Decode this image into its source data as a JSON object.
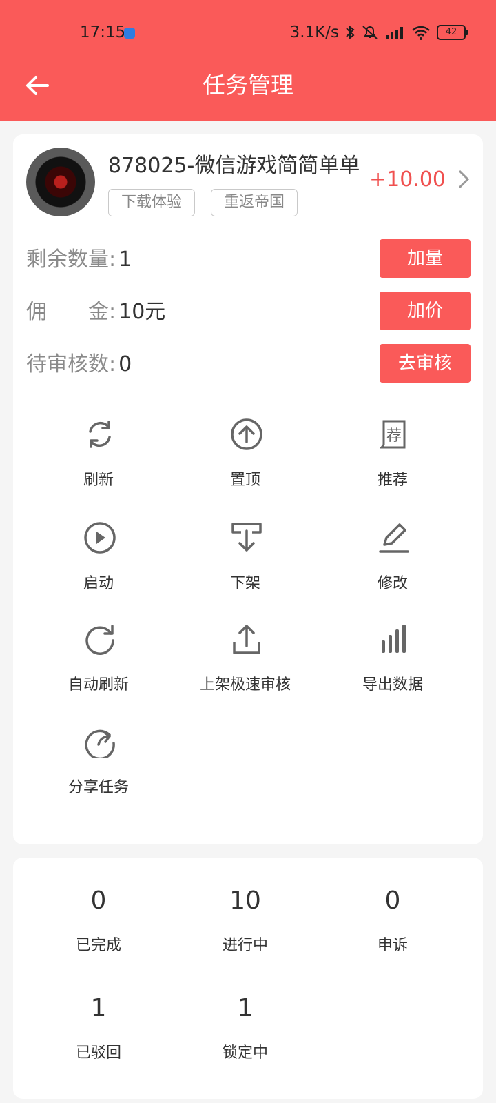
{
  "status_bar": {
    "time": "17:15",
    "net_speed": "3.1K/s",
    "battery": "42"
  },
  "header": {
    "title": "任务管理",
    "accent_color": "#fa5a59"
  },
  "task": {
    "title": "878025-微信游戏简简单单",
    "tags": [
      "下载体验",
      "重返帝国"
    ],
    "price": "+10.00"
  },
  "info": {
    "remaining_label": "剩余数量:",
    "remaining_value": "1",
    "commission_label": "佣　　金:",
    "commission_value": "10元",
    "pending_label": "待审核数:",
    "pending_value": "0",
    "add_qty_button": "加量",
    "add_price_button": "加价",
    "review_button": "去审核"
  },
  "operations": [
    {
      "label": "刷新",
      "icon": "refresh-icon"
    },
    {
      "label": "置顶",
      "icon": "arrow-up-circle-icon"
    },
    {
      "label": "推荐",
      "icon": "recommend-icon"
    },
    {
      "label": "启动",
      "icon": "play-icon"
    },
    {
      "label": "下架",
      "icon": "download-tray-icon"
    },
    {
      "label": "修改",
      "icon": "edit-icon"
    },
    {
      "label": "自动刷新",
      "icon": "auto-refresh-icon"
    },
    {
      "label": "上架极速审核",
      "icon": "upload-icon"
    },
    {
      "label": "导出数据",
      "icon": "bar-chart-icon"
    },
    {
      "label": "分享任务",
      "icon": "share-icon"
    }
  ],
  "stats": [
    {
      "value": "0",
      "label": "已完成"
    },
    {
      "value": "10",
      "label": "进行中"
    },
    {
      "value": "0",
      "label": "申诉"
    },
    {
      "value": "1",
      "label": "已驳回"
    },
    {
      "value": "1",
      "label": "锁定中"
    }
  ]
}
